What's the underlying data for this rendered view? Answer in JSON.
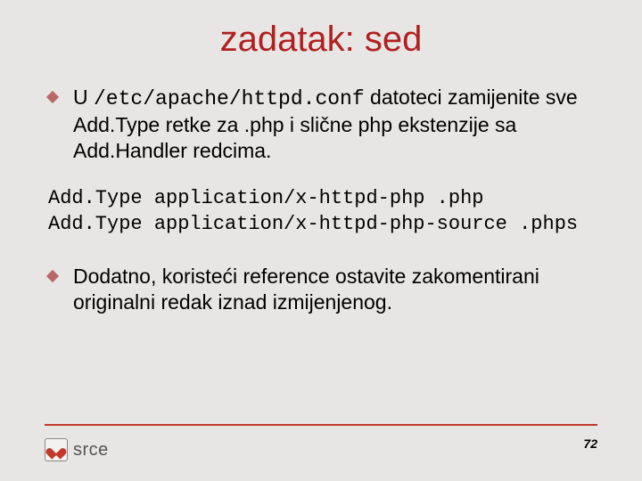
{
  "title": "zadatak: sed",
  "bullets": [
    {
      "pre": "U ",
      "code": "/etc/apache/httpd.conf",
      "post": " datoteci zamijenite sve Add.Type retke za .php i slične php ekstenzije sa Add.Handler redcima."
    },
    {
      "pre": "Dodatno, koristeći reference ostavite zakomentirani originalni redak iznad izmijenjenog.",
      "code": "",
      "post": ""
    }
  ],
  "code_lines": [
    "Add.Type application/x-httpd-php .php",
    "Add.Type application/x-httpd-php-source .phps"
  ],
  "footer": {
    "page": "72",
    "brand": "srce"
  }
}
